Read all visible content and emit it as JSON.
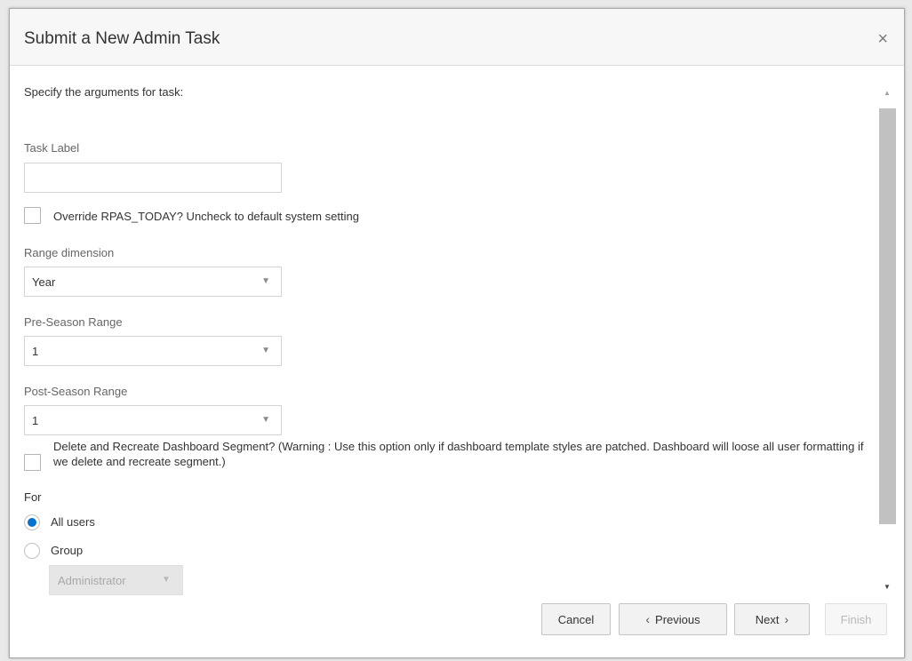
{
  "dialog": {
    "title": "Submit a New Admin Task",
    "close_label": "×"
  },
  "form": {
    "intro": "Specify the arguments for task:",
    "task_label": {
      "label": "Task Label",
      "value": ""
    },
    "override_today": {
      "label": "Override RPAS_TODAY? Uncheck to default system setting",
      "checked": false
    },
    "range_dimension": {
      "label": "Range dimension",
      "value": "Year",
      "arrow": "▼"
    },
    "pre_season": {
      "label": "Pre-Season Range",
      "value": "1",
      "arrow": "▼"
    },
    "post_season": {
      "label": "Post-Season Range",
      "value": "1",
      "arrow": "▼"
    },
    "recreate_segment": {
      "label": "Delete and Recreate Dashboard Segment? (Warning : Use this option only if dashboard template styles are patched. Dashboard will loose all user formatting if we delete and recreate segment.)",
      "checked": false
    },
    "for_label": "For",
    "radio_all_users": {
      "label": "All users",
      "selected": true
    },
    "radio_group": {
      "label": "Group",
      "selected": false
    },
    "group_select": {
      "value": "Administrator",
      "arrow": "▼"
    }
  },
  "scrollbar": {
    "up": "▲",
    "down": "▼"
  },
  "footer": {
    "cancel": "Cancel",
    "previous": "Previous",
    "previous_icon": "‹",
    "next": "Next",
    "next_icon": "›",
    "finish": "Finish"
  },
  "colors": {
    "accent": "#0572ce",
    "header_bg": "#f7f7f7",
    "button_bg": "#f2f2f2"
  }
}
